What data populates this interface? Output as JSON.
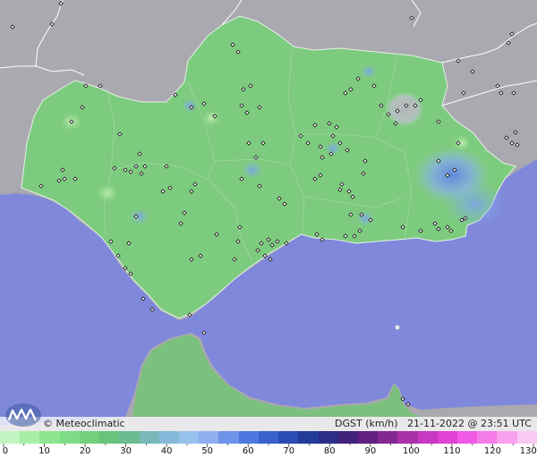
{
  "caption": {
    "credit": "© Meteoclimatic",
    "variable": "DGST (km/h)",
    "datetime": "21-11-2022 @ 23:51 UTC"
  },
  "legend": {
    "labels": [
      "0",
      "10",
      "20",
      "30",
      "40",
      "50",
      "60",
      "70",
      "80",
      "90",
      "100",
      "110",
      "120",
      "130"
    ],
    "colors": [
      "#c2f5c2",
      "#a8eea8",
      "#90e690",
      "#7edc86",
      "#72d07c",
      "#68c47a",
      "#6cbc90",
      "#78b8b8",
      "#86bada",
      "#98c2ee",
      "#8fb0f0",
      "#6e94ea",
      "#4e78e0",
      "#3a62cc",
      "#2a4cb4",
      "#223c98",
      "#2a2e84",
      "#42227a",
      "#62207e",
      "#842890",
      "#a832a8",
      "#c838c0",
      "#e042d4",
      "#f05ae4",
      "#f47ce8",
      "#f8a2ee",
      "#fac8f4"
    ]
  },
  "colors": {
    "sea": "#8088dc",
    "land_gray": "#a8a8ae",
    "land_green": "#78cc7c",
    "border": "#ffffff"
  }
}
